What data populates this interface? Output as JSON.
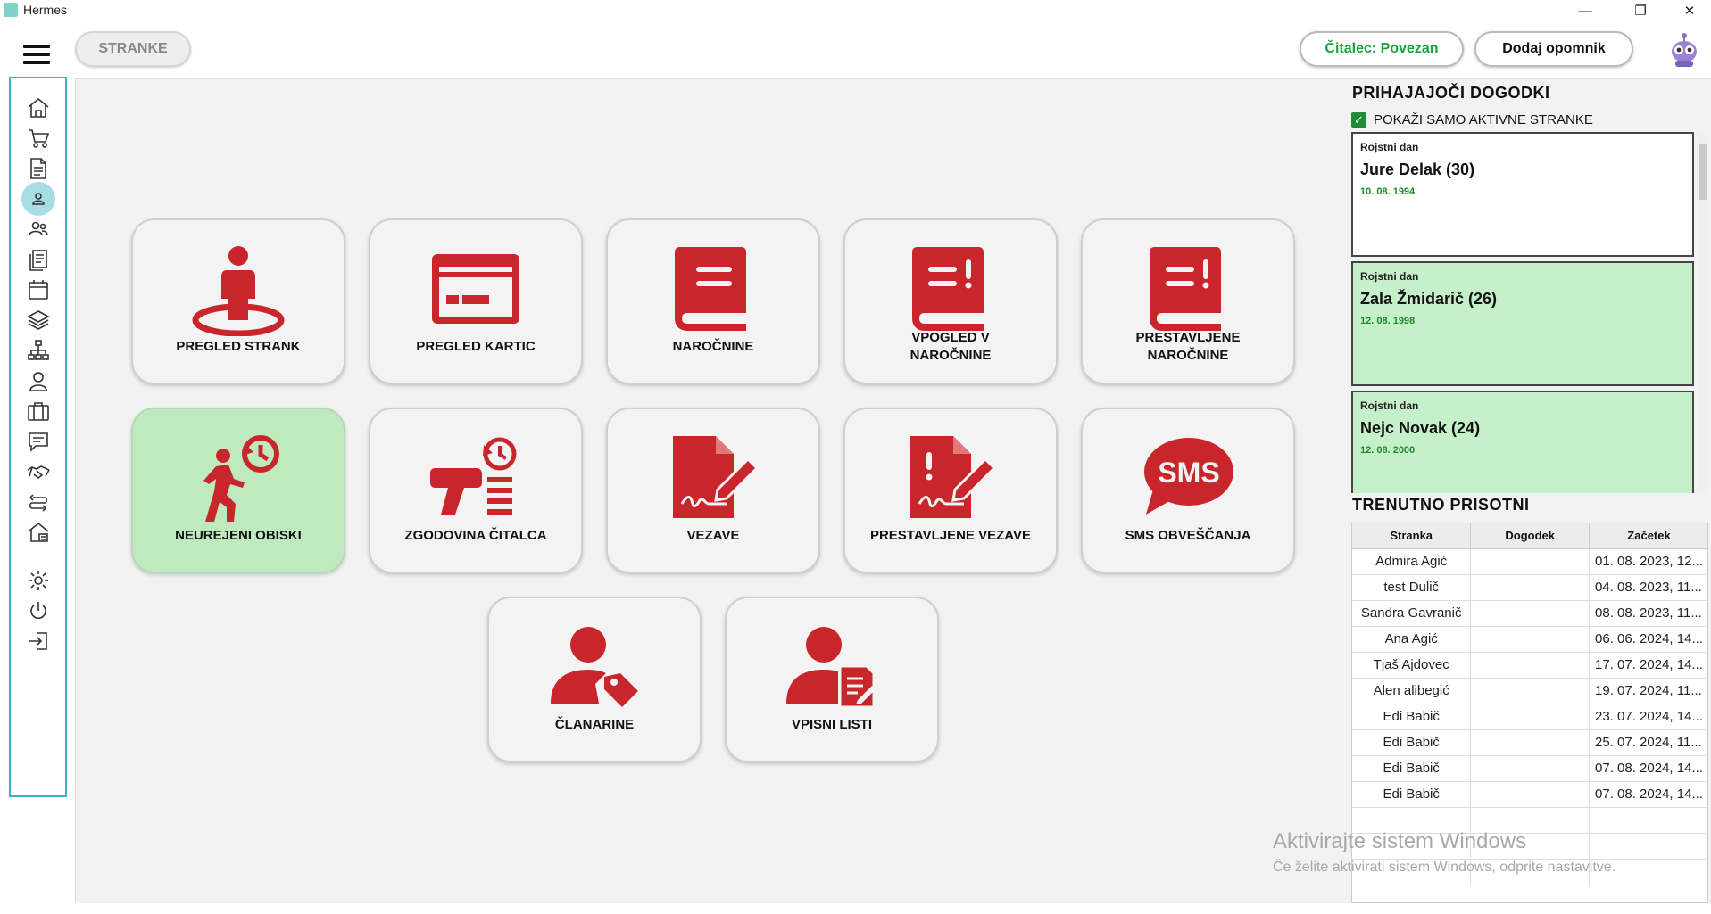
{
  "window": {
    "title": "Hermes",
    "minimize": "—",
    "maximize": "❐",
    "close": "✕"
  },
  "topbar": {
    "stranke_label": "STRANKE",
    "reader_status": "Čitalec: Povezan",
    "add_reminder": "Dodaj opomnik"
  },
  "sidebar": {
    "items": [
      "home-icon",
      "cart-icon",
      "document-icon",
      "user-icon",
      "users-icon",
      "list-icon",
      "calendar-icon",
      "layers-icon",
      "network-icon",
      "staff-icon",
      "briefcase-icon",
      "chat-icon",
      "handshake-icon",
      "transfer-icon",
      "building-icon"
    ],
    "bottom_items": [
      "gear-icon",
      "power-icon",
      "logout-icon"
    ]
  },
  "tiles": [
    {
      "label": "PREGLED STRANK"
    },
    {
      "label": "PREGLED KARTIC"
    },
    {
      "label": "NAROČNINE"
    },
    {
      "label": "VPOGLED V\nNAROČNINE"
    },
    {
      "label": "PRESTAVLJENE\nNAROČNINE"
    },
    {
      "label": "NEUREJENI OBISKI"
    },
    {
      "label": "ZGODOVINA ČITALCA"
    },
    {
      "label": "VEZAVE"
    },
    {
      "label": "PRESTAVLJENE VEZAVE"
    },
    {
      "label": "SMS OBVEŠČANJA"
    },
    {
      "label": "ČLANARINE"
    },
    {
      "label": "VPISNI LISTI"
    }
  ],
  "upcoming": {
    "title": "PRIHAJAJOČI DOGODKI",
    "filter_label": "POKAŽI SAMO AKTIVNE STRANKE",
    "events": [
      {
        "type": "Rojstni dan",
        "name": "Jure Delak (30)",
        "date": "10. 08. 1994"
      },
      {
        "type": "Rojstni dan",
        "name": "Zala Žmidarič (26)",
        "date": "12. 08. 1998"
      },
      {
        "type": "Rojstni dan",
        "name": "Nejc Novak (24)",
        "date": "12. 08. 2000"
      }
    ]
  },
  "present": {
    "title": "TRENUTNO PRISOTNI",
    "columns": [
      "Stranka",
      "Dogodek",
      "Začetek"
    ],
    "rows": [
      [
        "Admira Agić",
        "",
        "01. 08. 2023, 12..."
      ],
      [
        "test Dulič",
        "",
        "04. 08. 2023, 11..."
      ],
      [
        "Sandra Gavranič",
        "",
        "08. 08. 2023, 11..."
      ],
      [
        "Ana Agić",
        "",
        "06. 06. 2024, 14..."
      ],
      [
        "Tjaš Ajdovec",
        "",
        "17. 07. 2024, 14..."
      ],
      [
        "Alen alibegić",
        "",
        "19. 07. 2024, 11..."
      ],
      [
        "Edi Babič",
        "",
        "23. 07. 2024, 14..."
      ],
      [
        "Edi Babič",
        "",
        "25. 07. 2024, 11..."
      ],
      [
        "Edi Babič",
        "",
        "07. 08. 2024, 14..."
      ],
      [
        "Edi Babič",
        "",
        "07. 08. 2024, 14..."
      ]
    ]
  },
  "watermark": {
    "line1": "Aktivirajte sistem Windows",
    "line2": "Če želite aktivirati sistem Windows, odprite nastavitve."
  },
  "colors": {
    "accent_red": "#c9262c",
    "sidebar_border": "#39b3c7",
    "active_green": "#bfeabf",
    "status_green": "#1aa33a"
  }
}
